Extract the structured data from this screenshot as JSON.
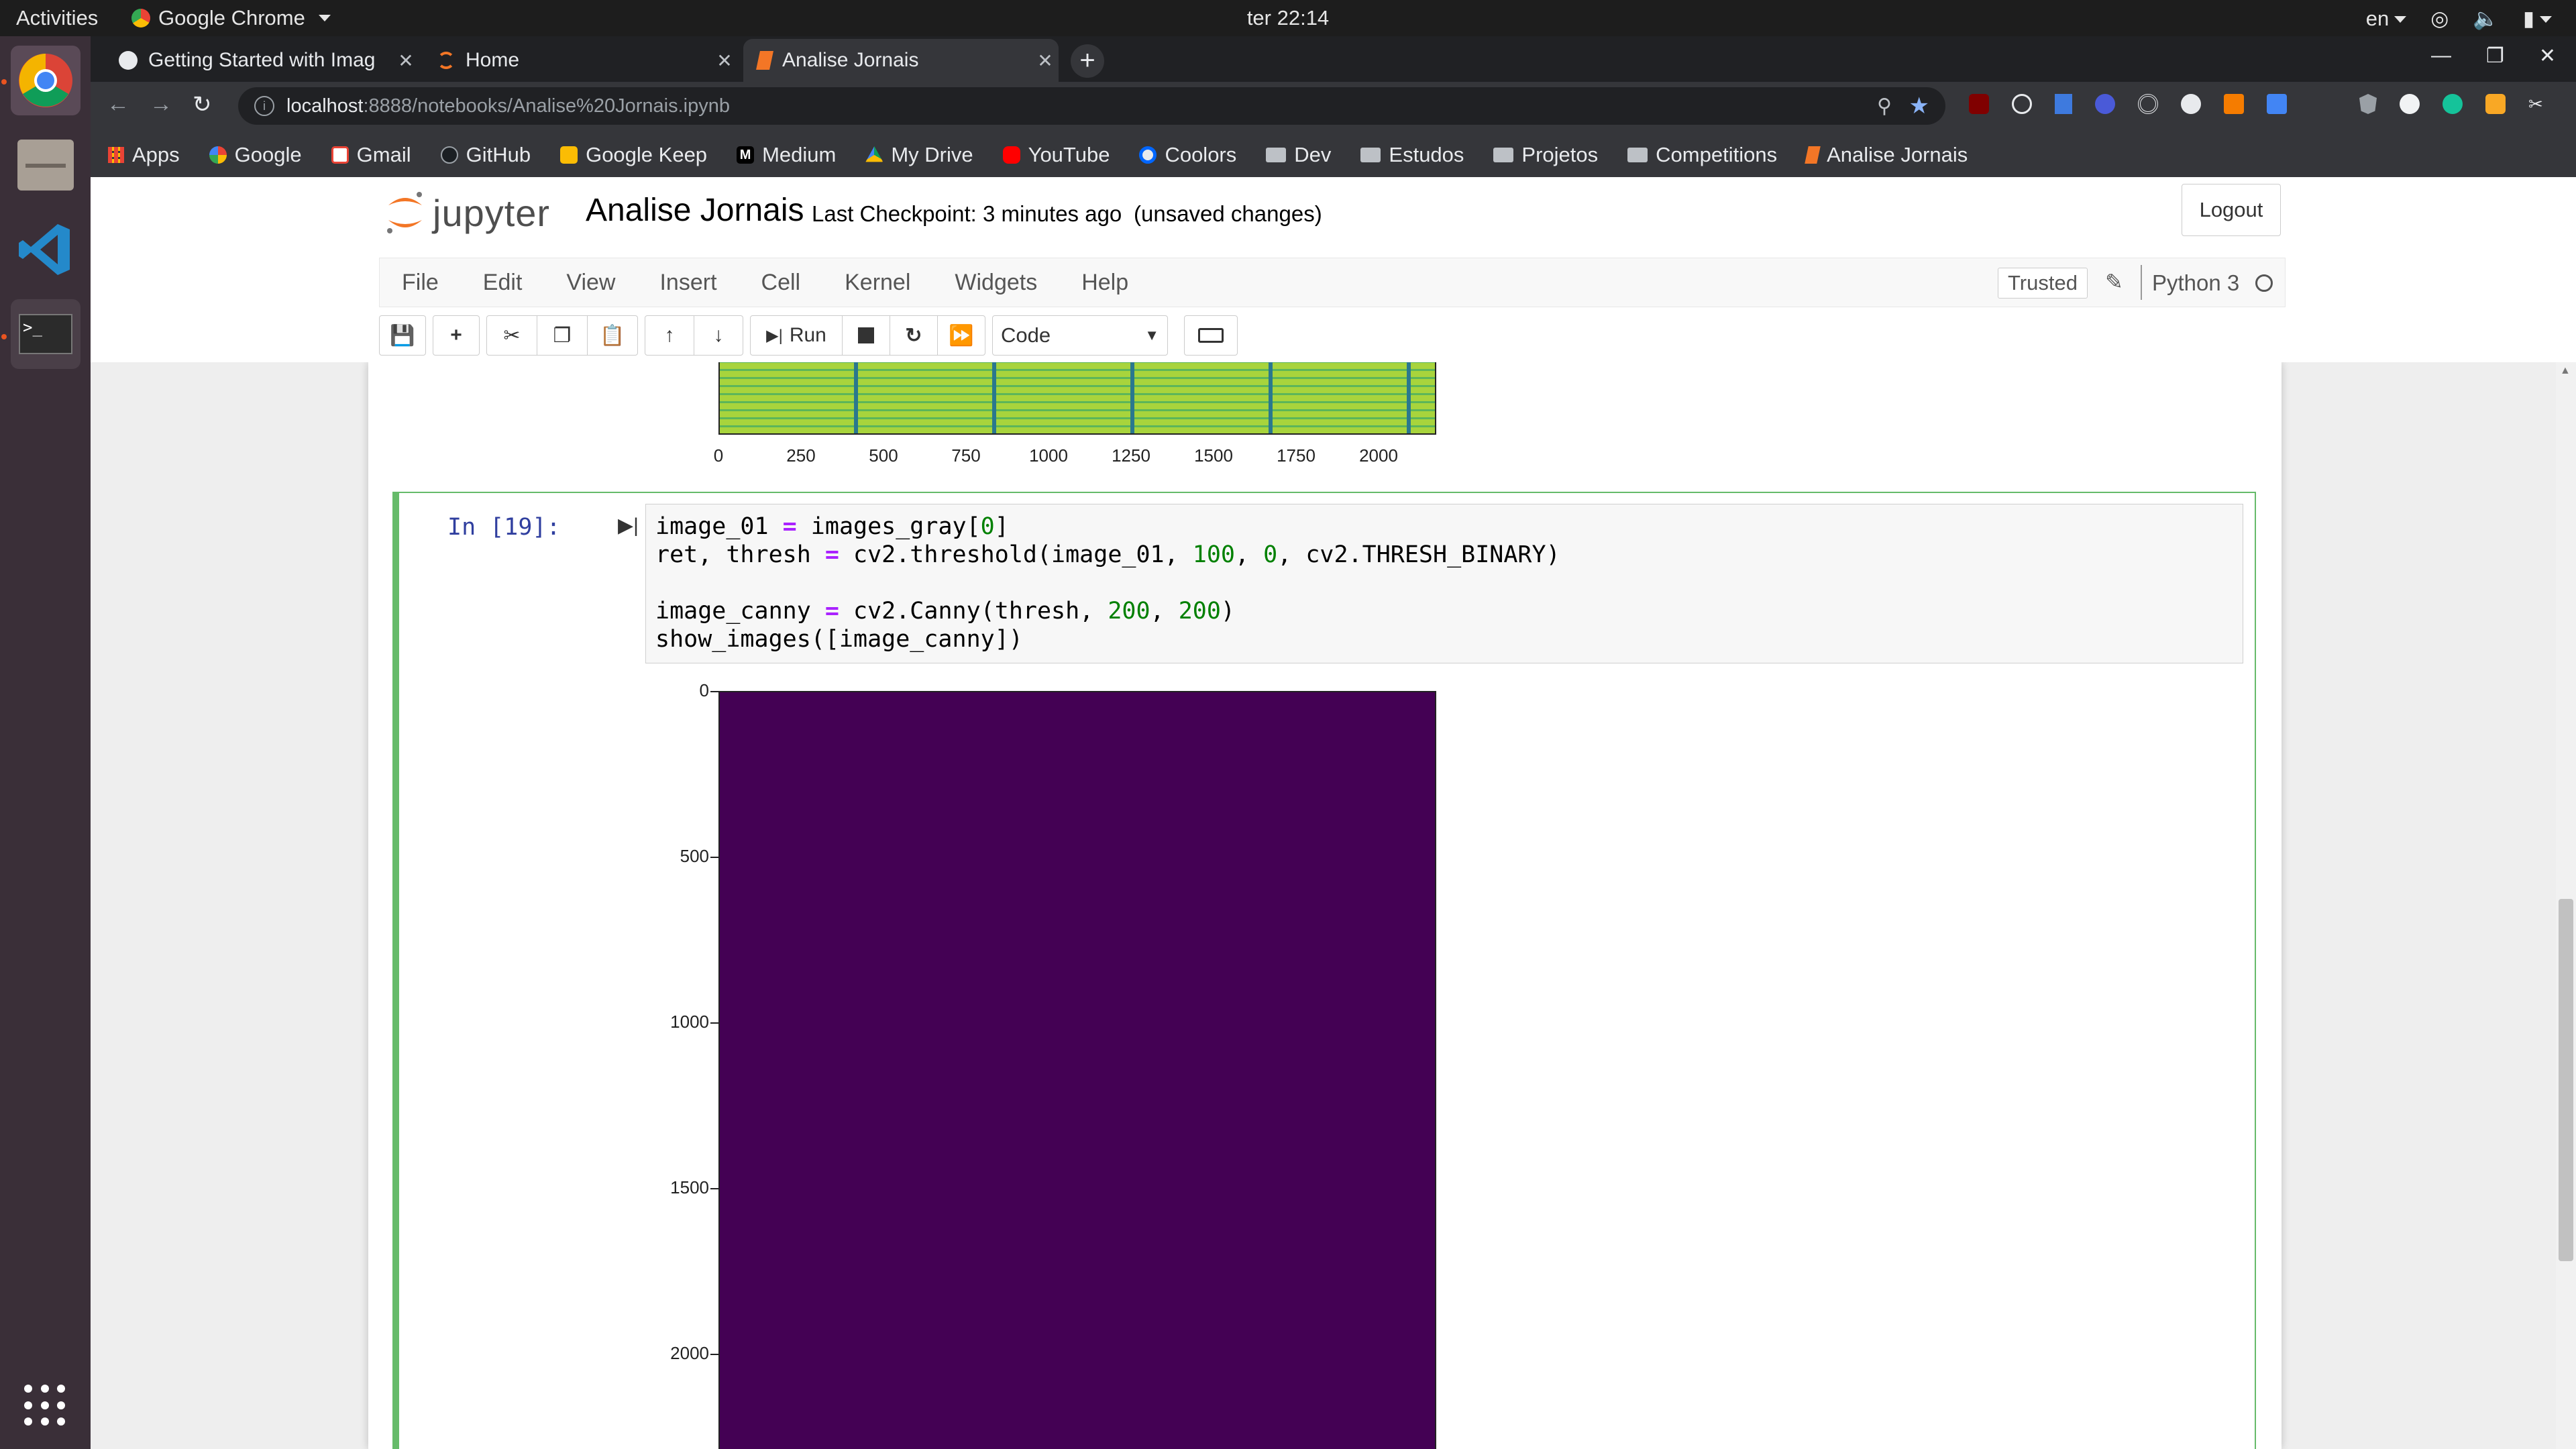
{
  "topbar": {
    "activities": "Activities",
    "app_name": "Google Chrome",
    "clock": "ter 22:14",
    "lang": "en"
  },
  "tabs": [
    {
      "title": "Getting Started with Imag",
      "icon": "globe-icon"
    },
    {
      "title": "Home",
      "icon": "jupyter-icon"
    },
    {
      "title": "Analise Jornais",
      "icon": "notebook-icon"
    }
  ],
  "address": {
    "host": "localhost",
    "path": ":8888/notebooks/Analise%20Jornais.ipynb"
  },
  "bookmarks": [
    {
      "label": "Apps",
      "icon": "apps-grid-icon"
    },
    {
      "label": "Google",
      "icon": "google-icon"
    },
    {
      "label": "Gmail",
      "icon": "gmail-icon"
    },
    {
      "label": "GitHub",
      "icon": "github-icon"
    },
    {
      "label": "Google Keep",
      "icon": "keep-icon"
    },
    {
      "label": "Medium",
      "icon": "medium-icon"
    },
    {
      "label": "My Drive",
      "icon": "drive-icon"
    },
    {
      "label": "YouTube",
      "icon": "youtube-icon"
    },
    {
      "label": "Coolors",
      "icon": "coolors-icon"
    },
    {
      "label": "Dev",
      "icon": "folder-icon"
    },
    {
      "label": "Estudos",
      "icon": "folder-icon"
    },
    {
      "label": "Projetos",
      "icon": "folder-icon"
    },
    {
      "label": "Competitions",
      "icon": "folder-icon"
    },
    {
      "label": "Analise Jornais",
      "icon": "notebook-icon"
    }
  ],
  "jupyter": {
    "logo_text": "jupyter",
    "notebook_name": "Analise Jornais",
    "checkpoint": "Last Checkpoint: 3 minutes ago",
    "unsaved": "(unsaved changes)",
    "logout": "Logout",
    "menu": [
      "File",
      "Edit",
      "View",
      "Insert",
      "Cell",
      "Kernel",
      "Widgets",
      "Help"
    ],
    "trusted": "Trusted",
    "kernel": "Python 3",
    "run_label": "Run",
    "cell_type": "Code"
  },
  "prev_output": {
    "x_ticks": [
      "0",
      "250",
      "500",
      "750",
      "1000",
      "1250",
      "1500",
      "1750",
      "2000"
    ]
  },
  "cell": {
    "prompt": "In [19]:",
    "code_lines": [
      "image_01 = images_gray[0]",
      "ret, thresh = cv2.threshold(image_01, 100, 0, cv2.THRESH_BINARY)",
      "",
      "image_canny = cv2.Canny(thresh, 200, 200)",
      "show_images([image_canny])"
    ]
  },
  "output_plot": {
    "y_ticks": [
      "0",
      "500",
      "1000",
      "1500",
      "2000"
    ],
    "fill_color": "#440154"
  },
  "colors": {
    "chrome_dark": "#202124",
    "chrome_tab": "#35363a",
    "jupyter_orange": "#f37626",
    "cell_green": "#66bb6a",
    "prompt_blue": "#303f9f",
    "viridis_yellow_green": "#a8d43c"
  }
}
